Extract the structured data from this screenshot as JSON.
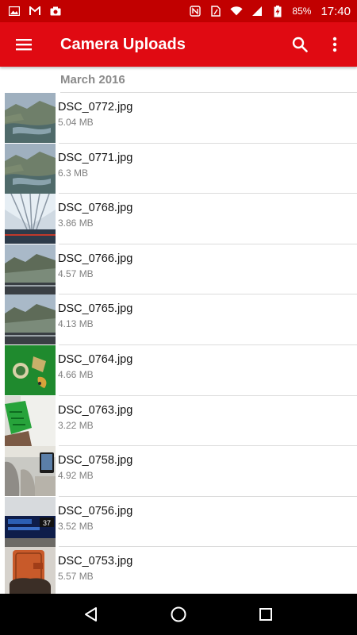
{
  "status_bar": {
    "battery_pct": "85%",
    "time": "17:40",
    "left_icons": [
      "image-icon",
      "gmail-icon",
      "camera-icon"
    ],
    "right_icons": [
      "nfc-icon",
      "sim-icon",
      "wifi-icon",
      "signal-icon",
      "battery-charging-icon"
    ]
  },
  "app_bar": {
    "title": "Camera Uploads",
    "color": "#e00a12"
  },
  "section": {
    "header": "March 2016"
  },
  "files": [
    {
      "name": "DSC_0772.jpg",
      "size": "5.04 MB",
      "thumb": "lake-valley"
    },
    {
      "name": "DSC_0771.jpg",
      "size": "6.3 MB",
      "thumb": "lake-valley"
    },
    {
      "name": "DSC_0768.jpg",
      "size": "3.86 MB",
      "thumb": "glass-ceiling"
    },
    {
      "name": "DSC_0766.jpg",
      "size": "4.57 MB",
      "thumb": "mountain-road"
    },
    {
      "name": "DSC_0765.jpg",
      "size": "4.13 MB",
      "thumb": "mountain-road"
    },
    {
      "name": "DSC_0764.jpg",
      "size": "4.66 MB",
      "thumb": "green-table"
    },
    {
      "name": "DSC_0763.jpg",
      "size": "3.22 MB",
      "thumb": "green-card"
    },
    {
      "name": "DSC_0758.jpg",
      "size": "4.92 MB",
      "thumb": "airplane-cabin"
    },
    {
      "name": "DSC_0756.jpg",
      "size": "3.52 MB",
      "thumb": "screen-display"
    },
    {
      "name": "DSC_0753.jpg",
      "size": "5.57 MB",
      "thumb": "luggage"
    }
  ],
  "thumb_badge": "37",
  "nav_bar": {
    "icons": [
      "back-icon",
      "home-icon",
      "recents-icon"
    ]
  }
}
